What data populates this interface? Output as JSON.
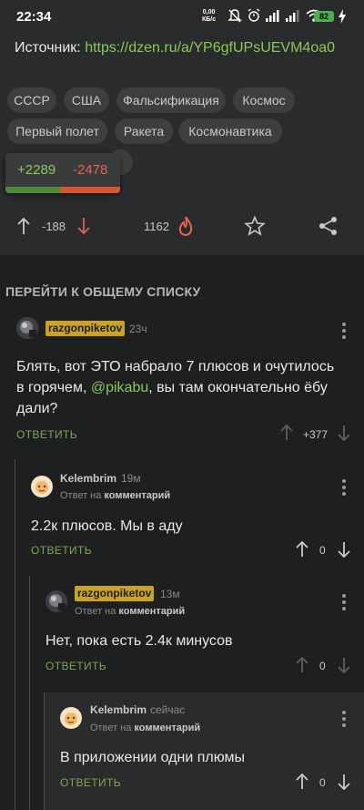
{
  "status_bar": {
    "time": "22:34",
    "net_speed_value": "0,00",
    "net_speed_unit": "КБ/с",
    "battery": "82"
  },
  "post": {
    "source_label": "Источник:",
    "source_url": "https://dzen.ru/a/YP6gfUPsUEVM4oa0",
    "tags": [
      "СССР",
      "США",
      "Фальсификация",
      "Космос",
      "Первый полет",
      "Ракета",
      "Космонавтика"
    ],
    "rating_popup": {
      "pluses": "+2289",
      "minuses": "-2478",
      "plus_fraction": 0.48
    },
    "actions": {
      "rating": "-188",
      "hot_count": "1162"
    }
  },
  "back_to_list": "ПЕРЕЙТИ К ОБЩЕМУ СПИСКУ",
  "comments": [
    {
      "user": "razgonpiketov",
      "time": "23ч",
      "text_before": "Блять, вот ЭТО набрало 7 плюсов и очутилось в горячем, ",
      "mention": "@pikabu",
      "text_after": ", вы там окончательно ёбу дали?",
      "reply_label": "ОТВЕТИТЬ",
      "score": "+377"
    },
    {
      "user": "Kelembrim",
      "time": "19м",
      "reply_prefix": "Ответ на",
      "reply_target": "комментарий",
      "text": "2.2к плюсов. Мы в аду",
      "reply_label": "ОТВЕТИТЬ",
      "score": "0"
    },
    {
      "user": "razgonpiketov",
      "time": "13м",
      "reply_prefix": "Ответ на",
      "reply_target": "комментарий",
      "text": "Нет, пока есть 2.4к минусов",
      "reply_label": "ОТВЕТИТЬ",
      "score": "0"
    },
    {
      "user": "Kelembrim",
      "time": "сейчас",
      "reply_prefix": "Ответ на",
      "reply_target": "комментарий",
      "text": "В приложении одни плюмы",
      "reply_label": "ОТВЕТИТЬ",
      "score": "0"
    }
  ],
  "colors": {
    "accent_green": "#8ac858",
    "minus_red": "#e0654a",
    "user_badge": "#c9a227",
    "background": "#1e1f21",
    "card": "#2a2b2d"
  },
  "icons": [
    "wifi-icon",
    "signal-icon",
    "mute-icon",
    "alarm-icon",
    "battery-icon",
    "arrow-up-icon",
    "arrow-down-icon",
    "fire-icon",
    "star-icon",
    "share-icon",
    "more-icon"
  ]
}
